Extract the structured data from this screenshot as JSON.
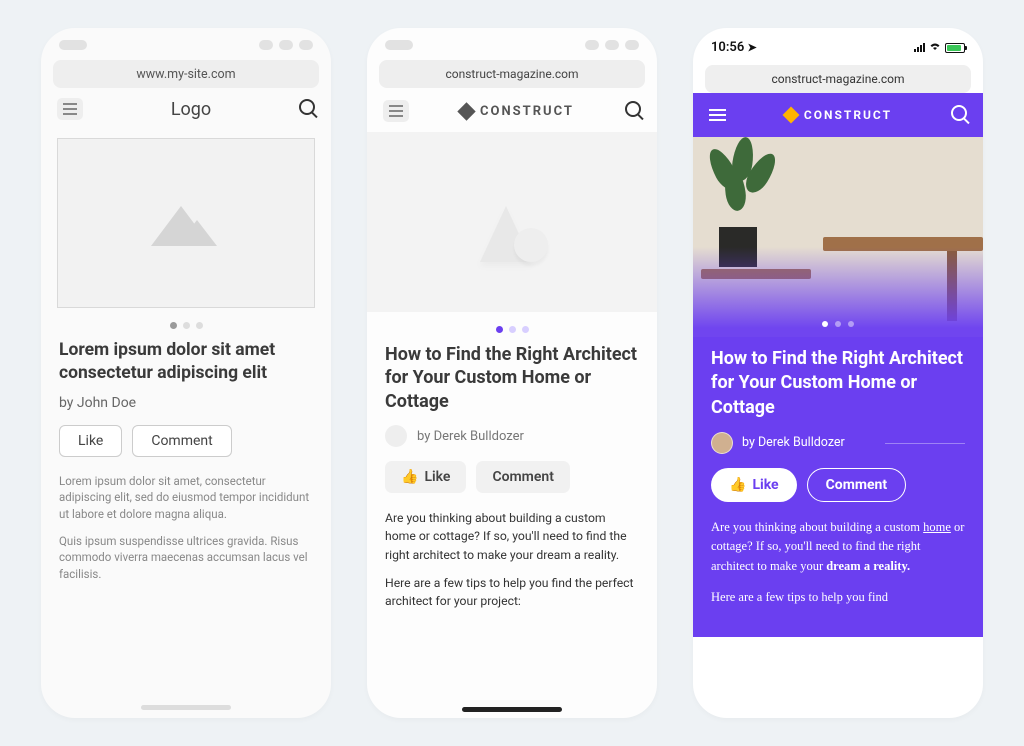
{
  "phone1": {
    "url": "www.my-site.com",
    "logo": "Logo",
    "title": "Lorem ipsum dolor sit amet consectetur adipiscing elit",
    "author": "by John Doe",
    "like": "Like",
    "comment": "Comment",
    "para1": "Lorem ipsum dolor sit amet, consectetur adipiscing elit, sed do eiusmod tempor incididunt ut labore et dolore magna aliqua.",
    "para2": "Quis ipsum suspendisse ultrices gravida. Risus commodo viverra maecenas accumsan lacus vel facilisis."
  },
  "phone2": {
    "url": "construct-magazine.com",
    "brand": "CONSTRUCT",
    "title": "How to Find the Right Architect for Your Custom Home or Cottage",
    "author": "by Derek Bulldozer",
    "like": "Like",
    "comment": "Comment",
    "para1": "Are you thinking about building a custom home or cottage? If so, you'll need to find the right architect to make your dream a reality.",
    "para2": "Here are a few tips to help you find the perfect architect for your project:"
  },
  "phone3": {
    "time": "10:56",
    "url": "construct-magazine.com",
    "brand": "CONSTRUCT",
    "title": "How to Find the Right Architect for Your Custom Home or Cottage",
    "author": "by Derek Bulldozer",
    "like": "Like",
    "comment": "Comment",
    "para2": "Here are a few tips to help you find"
  }
}
